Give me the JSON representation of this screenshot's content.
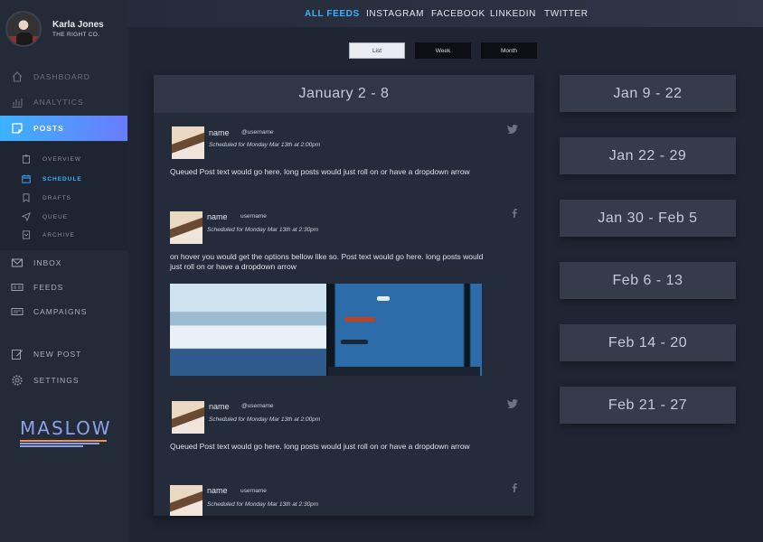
{
  "profile": {
    "name": "Karla Jones",
    "company": "THE RIGHT CO."
  },
  "sidebar": {
    "items": [
      {
        "id": "dashboard",
        "label": "DASHBOARD",
        "icon": "home-icon"
      },
      {
        "id": "analytics",
        "label": "ANALYTICS",
        "icon": "bar-chart-icon"
      },
      {
        "id": "posts",
        "label": "POSTS",
        "icon": "note-icon",
        "active": true
      },
      {
        "id": "inbox",
        "label": "INBOX",
        "icon": "mail-icon"
      },
      {
        "id": "feeds",
        "label": "FEEDS",
        "icon": "feed-icon"
      },
      {
        "id": "campaigns",
        "label": "CAMPAIGNS",
        "icon": "campaign-icon"
      },
      {
        "id": "new_post",
        "label": "NEW POST",
        "icon": "edit-icon"
      },
      {
        "id": "settings",
        "label": "SETTINGS",
        "icon": "gear-icon"
      }
    ],
    "subitems": [
      {
        "label": "OVERVIEW",
        "icon": "clipboard-icon"
      },
      {
        "label": "SCHEDULE",
        "icon": "calendar-icon",
        "active": true
      },
      {
        "label": "DRAFTS",
        "icon": "bookmark-icon"
      },
      {
        "label": "QUEUE",
        "icon": "send-icon"
      },
      {
        "label": "ARCHIVE",
        "icon": "archive-icon"
      }
    ]
  },
  "brand": {
    "name": "MASLOW",
    "colors": [
      "#8ea0e6",
      "#3cb3ff",
      "#f0914d"
    ]
  },
  "topnav": {
    "items": [
      {
        "label": "ALL FEEDS",
        "active": true
      },
      {
        "label": "INSTAGRAM"
      },
      {
        "label": "FACEBOOK"
      },
      {
        "label": "LINKEDIN"
      },
      {
        "label": "TWITTER"
      }
    ]
  },
  "view_toggle": {
    "options": [
      {
        "label": "List",
        "active": true
      },
      {
        "label": "Week"
      },
      {
        "label": "Month"
      }
    ]
  },
  "feed": {
    "title": "January 2 - 8",
    "posts": [
      {
        "name": "name",
        "username": "@username",
        "schedule": "Scheduled for Monday Mar 13th at 2:00pm",
        "text": "Queued Post text would go here. long posts would just roll on or have a dropdown arrow",
        "network": "twitter-icon"
      },
      {
        "name": "name",
        "username": "username",
        "schedule": "Scheduled for Monday Mar 13th at 2:30pm",
        "text": "on hover you would get the options bellow like so. Post text would go here. long posts would just roll on or have a dropdown arrow",
        "network": "facebook-icon"
      },
      {
        "name": "name",
        "username": "@username",
        "schedule": "Scheduled for Monday Mar 13th at 2:00pm",
        "text": "Queued Post text would go here. long posts would just roll on or have a dropdown arrow",
        "network": "twitter-icon"
      },
      {
        "name": "name",
        "username": "username",
        "schedule": "Scheduled for Monday Mar 13th at 2:30pm",
        "text": "",
        "network": "facebook-icon"
      }
    ]
  },
  "weeks": [
    "Jan 9 - 22",
    "Jan 22 - 29",
    "Jan 30 - Feb 5",
    "Feb 6 - 13",
    "Feb 14 - 20",
    "Feb 21 - 27"
  ]
}
